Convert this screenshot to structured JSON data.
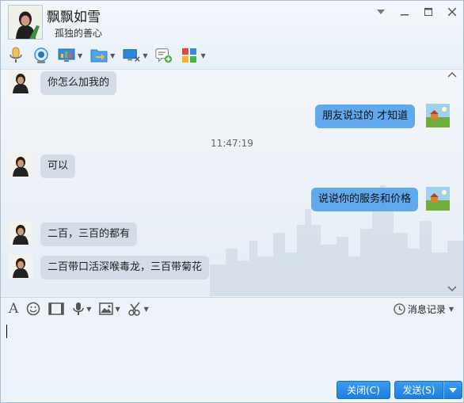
{
  "contact": {
    "name": "飘飘如雪",
    "signature": "孤独的善心"
  },
  "window_controls": [
    "menu-caret-icon",
    "minimize-icon",
    "maximize-icon",
    "close-icon"
  ],
  "toolbar_icons": [
    "voice-call-icon",
    "video-call-icon",
    "remote-desktop-icon",
    "send-file-icon",
    "screen-share-icon",
    "add-application-icon",
    "apps-grid-icon"
  ],
  "messages": [
    {
      "side": "left",
      "text": "你怎么加我的"
    },
    {
      "side": "right",
      "text": "朋友说过的  才知道"
    },
    {
      "side": "time",
      "text": "11:47:19"
    },
    {
      "side": "left",
      "text": "可以"
    },
    {
      "side": "right",
      "text": "说说你的服务和价格"
    },
    {
      "side": "left",
      "text": "二百，三百的都有"
    },
    {
      "side": "left",
      "text": "二百带口活深喉毒龙，三百带菊花"
    }
  ],
  "input_toolbar_icons": [
    "font-icon",
    "emoji-icon",
    "screenshot-icon",
    "voice-message-icon",
    "image-icon",
    "scissors-icon"
  ],
  "history_label": "消息记录",
  "buttons": {
    "close": "关闭(C)",
    "send": "发送(S)"
  },
  "colors": {
    "accent": "#1b7fe0",
    "bubble_right": "#5fa9ee",
    "bubble_left": "#d3dce7"
  }
}
